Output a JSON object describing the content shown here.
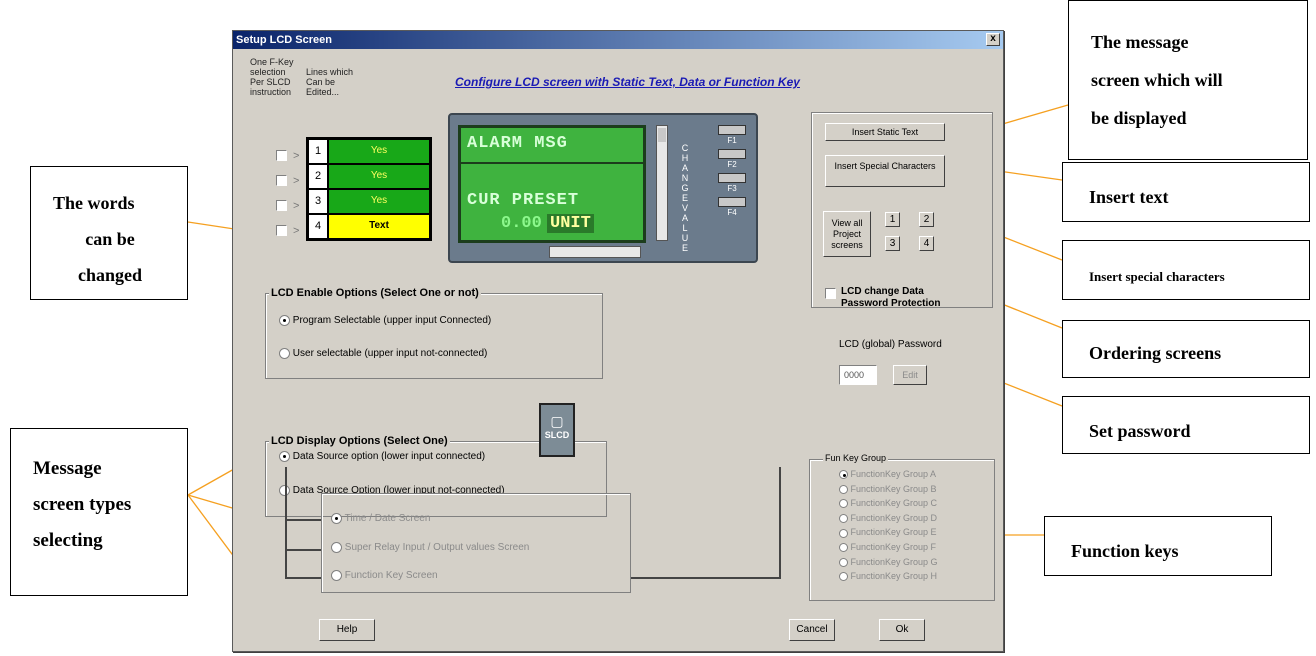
{
  "window": {
    "title": "Setup LCD Screen",
    "close_label": "x",
    "fkey_note": [
      "One F-Key",
      "selection",
      "Per SLCD",
      "instruction"
    ],
    "lines_note": [
      "Lines which",
      "Can be",
      "Edited..."
    ],
    "config_title": "Configure LCD screen with Static Text, Data or Function Key",
    "lines": [
      {
        "num": "1",
        "val": "Yes"
      },
      {
        "num": "2",
        "val": "Yes"
      },
      {
        "num": "3",
        "val": "Yes"
      },
      {
        "num": "4",
        "val": "Text"
      }
    ],
    "lcd": {
      "line1": "ALARM MSG",
      "line3": "CUR PRESET",
      "line4_value": "0.00",
      "line4_unit": "UNIT"
    },
    "change_value_label": "CHANGE VALUE",
    "fkeys": [
      "F1",
      "F2",
      "F3",
      "F4"
    ],
    "buttons": {
      "insert_static_text": "Insert Static Text",
      "insert_special": "Insert Special Characters",
      "view_all": "View all Project screens",
      "edit": "Edit",
      "help": "Help",
      "cancel": "Cancel",
      "ok": "Ok"
    },
    "screen_nums": [
      "1",
      "2",
      "3",
      "4"
    ],
    "password": {
      "check_label": "LCD change Data",
      "check_label2": "Password Protection",
      "global_label": "LCD (global) Password",
      "value": "0000"
    },
    "enable_options": {
      "legend": "LCD Enable Options (Select One or not)",
      "opt1": "Program Selectable (upper input Connected)",
      "opt2": "User selectable (upper input not-connected)"
    },
    "display_options": {
      "legend": "LCD Display Options (Select One)",
      "opt1": "Data Source option (lower input connected)",
      "opt2": "Data Source Option (lower input not-connected)"
    },
    "screen_types": [
      "Time / Date Screen",
      "Super Relay Input / Output values Screen",
      "Function Key Screen"
    ],
    "slcd_label": "SLCD",
    "fun_key_group": {
      "legend": "Fun Key Group",
      "items": [
        "FunctionKey Group A",
        "FunctionKey Group B",
        "FunctionKey Group C",
        "FunctionKey Group D",
        "FunctionKey Group E",
        "FunctionKey Group F",
        "FunctionKey Group G",
        "FunctionKey Group H"
      ]
    }
  },
  "annotations": {
    "words_changed": [
      "The words",
      "can be",
      "changed"
    ],
    "message_types": [
      "Message",
      "screen types",
      "selecting"
    ],
    "message_screen": [
      "The message",
      "screen which will",
      "be displayed"
    ],
    "insert_text": "Insert text",
    "insert_special": "Insert special characters",
    "ordering": "Ordering screens",
    "set_password": "Set password",
    "function_keys": "Function keys"
  },
  "colors": {
    "arrow": "#f5a020",
    "lcd_green": "#3fb33f",
    "title_blue": "#1a1ab4"
  }
}
